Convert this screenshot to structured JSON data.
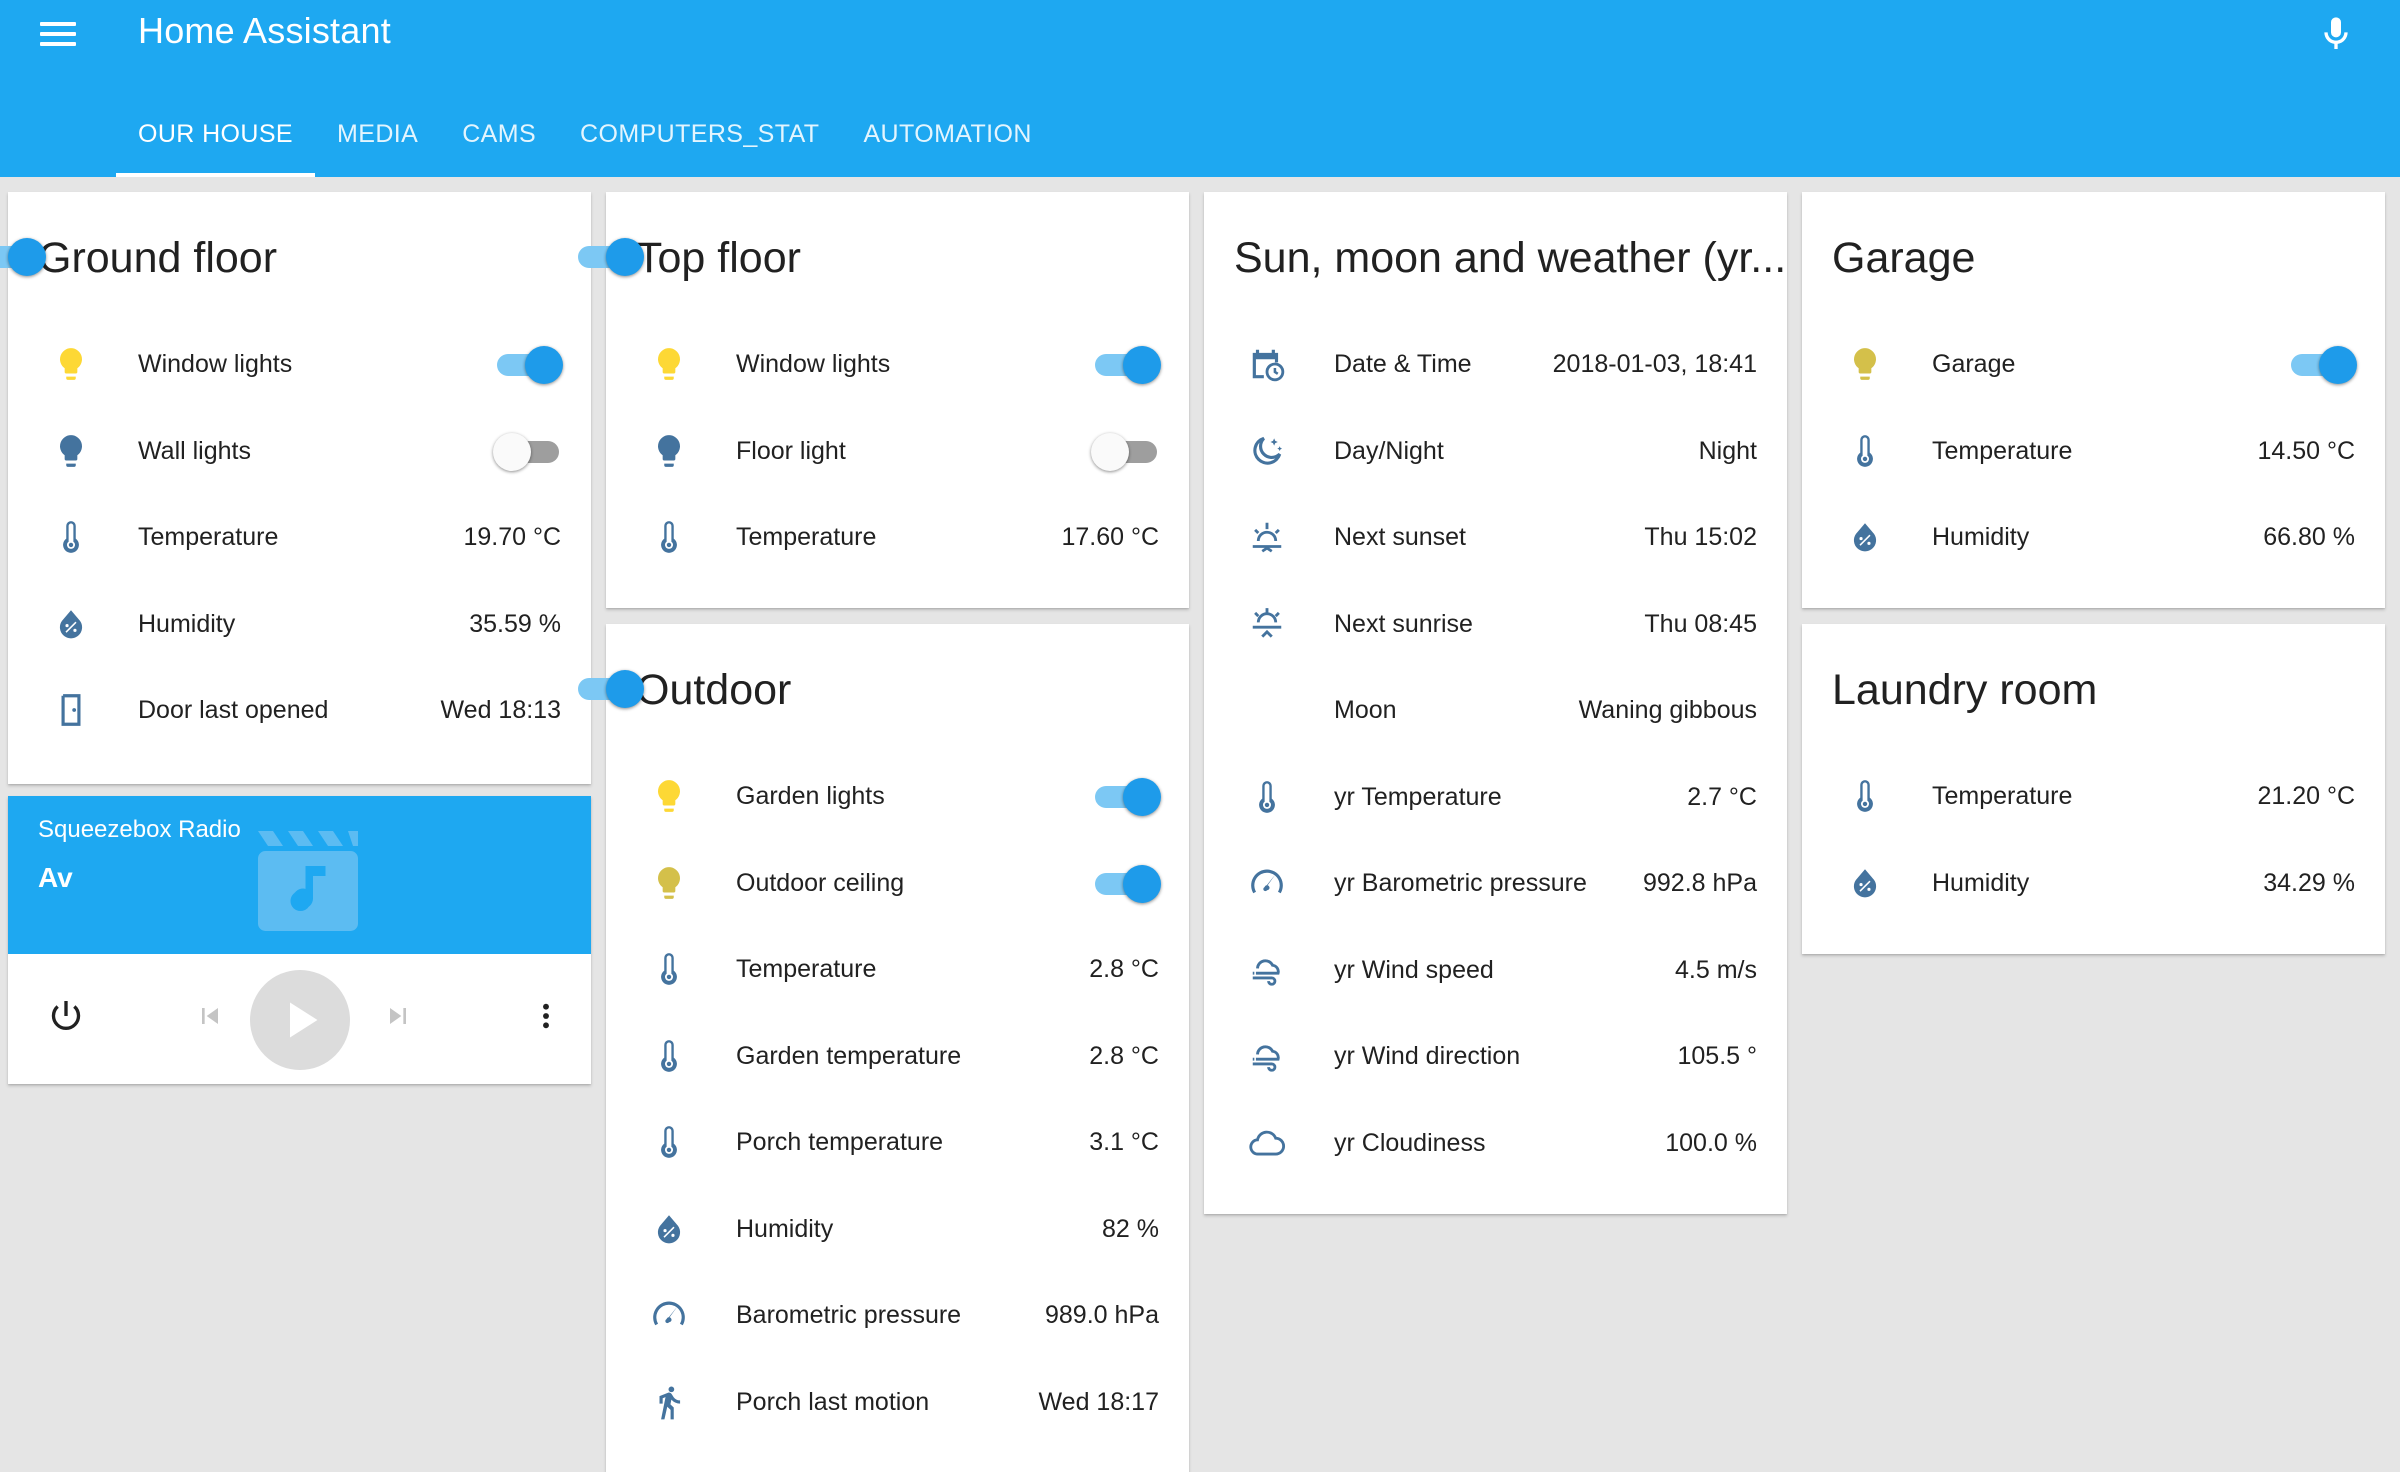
{
  "app": {
    "title": "Home Assistant"
  },
  "header": {
    "menu_icon": "menu-icon",
    "mic_icon": "microphone-icon"
  },
  "tabs": [
    {
      "label": "OUR HOUSE",
      "active": true
    },
    {
      "label": "MEDIA",
      "active": false
    },
    {
      "label": "CAMS",
      "active": false
    },
    {
      "label": "COMPUTERS_STAT",
      "active": false
    },
    {
      "label": "AUTOMATION",
      "active": false
    }
  ],
  "colors": {
    "accent": "#1ea8f1",
    "switch_on": "#1e9bea",
    "icon": "#44739e",
    "bulb_on": "#fdd835",
    "bulb_dim": "#d4c04a"
  },
  "cards": {
    "ground_floor": {
      "title": "Ground floor",
      "toggle_on": true,
      "rows": [
        {
          "icon": "bulb-on",
          "label": "Window lights",
          "toggle_on": true
        },
        {
          "icon": "bulb-off",
          "label": "Wall lights",
          "toggle_on": false
        },
        {
          "icon": "thermometer",
          "label": "Temperature",
          "value": "19.70 °C"
        },
        {
          "icon": "water-percent",
          "label": "Humidity",
          "value": "35.59 %"
        },
        {
          "icon": "door",
          "label": "Door last opened",
          "value": "Wed 18:13"
        }
      ]
    },
    "media_player": {
      "name": "Squeezebox Radio",
      "state": "Av",
      "art_icon": "movie-music-icon",
      "controls": [
        "power-icon",
        "previous-icon",
        "play-icon",
        "next-icon",
        "more-vertical-icon"
      ]
    },
    "top_floor": {
      "title": "Top floor",
      "toggle_on": true,
      "rows": [
        {
          "icon": "bulb-on",
          "label": "Window lights",
          "toggle_on": true
        },
        {
          "icon": "bulb-off",
          "label": "Floor light",
          "toggle_on": false
        },
        {
          "icon": "thermometer",
          "label": "Temperature",
          "value": "17.60 °C"
        }
      ]
    },
    "outdoor": {
      "title": "Outdoor",
      "toggle_on": true,
      "rows": [
        {
          "icon": "bulb-on",
          "label": "Garden lights",
          "toggle_on": true
        },
        {
          "icon": "bulb-dim",
          "label": "Outdoor ceiling",
          "toggle_on": true
        },
        {
          "icon": "thermometer",
          "label": "Temperature",
          "value": "2.8 °C"
        },
        {
          "icon": "thermometer",
          "label": "Garden temperature",
          "value": "2.8 °C"
        },
        {
          "icon": "thermometer",
          "label": "Porch temperature",
          "value": "3.1 °C"
        },
        {
          "icon": "water-percent",
          "label": "Humidity",
          "value": "82 %"
        },
        {
          "icon": "gauge",
          "label": "Barometric pressure",
          "value": "989.0 hPa"
        },
        {
          "icon": "walk",
          "label": "Porch last motion",
          "value": "Wed 18:17"
        }
      ]
    },
    "sun_moon": {
      "title": "Sun, moon and weather (yr...",
      "rows": [
        {
          "icon": "calendar-clock",
          "label": "Date & Time",
          "value": "2018-01-03, 18:41"
        },
        {
          "icon": "night",
          "label": "Day/Night",
          "value": "Night"
        },
        {
          "icon": "sunset",
          "label": "Next sunset",
          "value": "Thu 15:02"
        },
        {
          "icon": "sunrise",
          "label": "Next sunrise",
          "value": "Thu 08:45"
        },
        {
          "icon": "moon",
          "label": "Moon",
          "value": "Waning gibbous"
        },
        {
          "icon": "thermometer",
          "label": "yr Temperature",
          "value": "2.7 °C"
        },
        {
          "icon": "gauge",
          "label": "yr Barometric pressure",
          "value": "992.8 hPa"
        },
        {
          "icon": "wind",
          "label": "yr Wind speed",
          "value": "4.5 m/s"
        },
        {
          "icon": "wind",
          "label": "yr Wind direction",
          "value": "105.5 °"
        },
        {
          "icon": "cloud",
          "label": "yr Cloudiness",
          "value": "100.0 %"
        }
      ]
    },
    "garage": {
      "title": "Garage",
      "rows": [
        {
          "icon": "bulb-dim",
          "label": "Garage",
          "toggle_on": true
        },
        {
          "icon": "thermometer",
          "label": "Temperature",
          "value": "14.50 °C"
        },
        {
          "icon": "water-percent",
          "label": "Humidity",
          "value": "66.80 %"
        }
      ]
    },
    "laundry": {
      "title": "Laundry room",
      "rows": [
        {
          "icon": "thermometer",
          "label": "Temperature",
          "value": "21.20 °C"
        },
        {
          "icon": "water-percent",
          "label": "Humidity",
          "value": "34.29 %"
        }
      ]
    }
  }
}
